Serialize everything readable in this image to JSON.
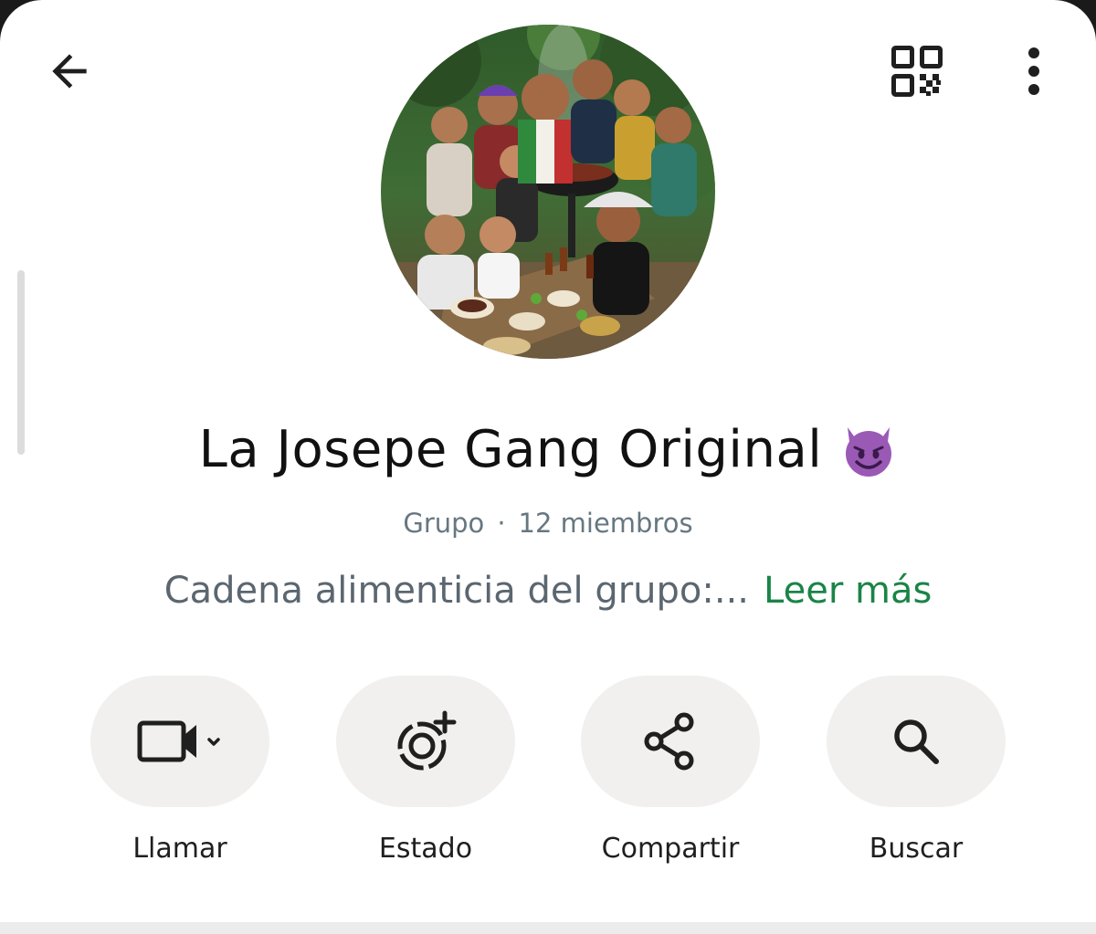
{
  "header": {
    "back_icon": "arrow-left-icon",
    "qr_icon": "qr-code-icon",
    "more_icon": "more-vertical-icon"
  },
  "profile": {
    "avatar_desc": "group-photo",
    "name": "La Josepe Gang Original",
    "name_emoji": "smiling-face-with-horns",
    "type": "Grupo",
    "separator": "·",
    "members": "12 miembros",
    "description": "Cadena alimenticia del grupo:...",
    "read_more": "Leer más"
  },
  "actions": [
    {
      "label": "Llamar",
      "icon": "video-call-icon"
    },
    {
      "label": "Estado",
      "icon": "status-add-icon"
    },
    {
      "label": "Compartir",
      "icon": "share-icon"
    },
    {
      "label": "Buscar",
      "icon": "search-icon"
    }
  ],
  "colors": {
    "accent_green": "#1a8447",
    "pill_bg": "#f1f0ef",
    "secondary_text": "#667781"
  }
}
